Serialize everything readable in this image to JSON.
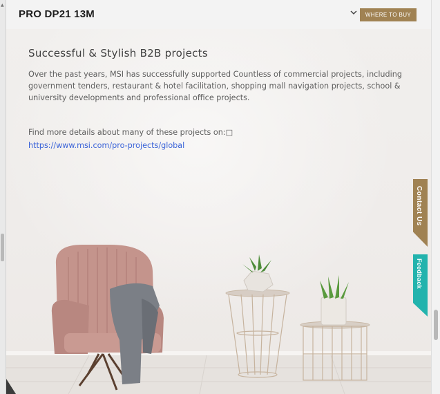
{
  "header": {
    "product_name": "PRO DP21 13M",
    "where_to_buy": "WHERE TO BUY"
  },
  "section": {
    "heading": "Successful & Stylish B2B projects",
    "body": "Over the past years, MSI has successfully supported Countless of commercial projects, including government tenders, restaurant & hotel facilitation, shopping mall navigation projects, school & university developments and professional office projects.",
    "more_details": "Find more details about many of these projects on:□",
    "link_text": "https://www.msi.com/pro-projects/global"
  },
  "side_tabs": {
    "contact": "Contact Us",
    "feedback": "Feedback"
  },
  "icons": {
    "dropdown": "chevron-down-icon"
  },
  "colors": {
    "accent_gold": "#a08253",
    "feedback_teal": "#22b3ad",
    "link_blue": "#3a63d8"
  }
}
